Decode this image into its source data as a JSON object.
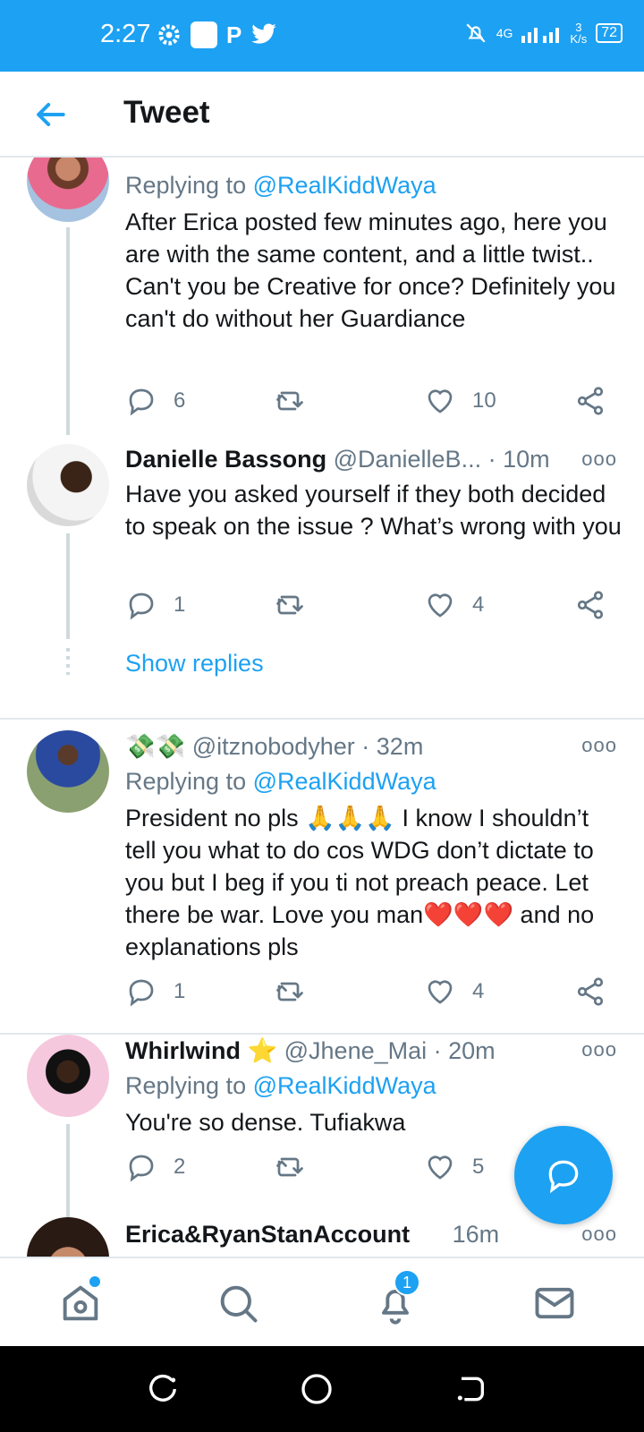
{
  "status_bar": {
    "time": "2:27",
    "left_icons": [
      "gear-icon",
      "square-icon",
      "p-icon",
      "twitter-bird-icon"
    ],
    "p_glyph": "P",
    "network": "4G",
    "speed": "3",
    "speed_unit": "K/s",
    "battery": "72"
  },
  "header": {
    "title": "Tweet",
    "back_icon": "back-arrow-icon"
  },
  "colors": {
    "accent": "#1da1f2",
    "muted": "#657786",
    "text": "#14171a",
    "divider": "#e1e8ed"
  },
  "tweets": [
    {
      "replying_label": "Replying to",
      "mention": "@RealKiddWaya",
      "body": "After Erica posted few minutes ago, here you are with the same content, and a little twist..\nCan't you be Creative for once? Definitely you can't do without her Guardiance",
      "counts": {
        "reply": "6",
        "like": "10"
      }
    },
    {
      "name": "Danielle Bassong",
      "handle": "@DanielleB...",
      "time": "· 10m",
      "body": "Have you asked yourself if they both decided to speak on the issue ? What’s wrong with you",
      "counts": {
        "reply": "1",
        "like": "4"
      }
    },
    {
      "name": "💸💸",
      "handle": "@itznobodyher",
      "time": "· 32m",
      "replying_label": "Replying to",
      "mention": "@RealKiddWaya",
      "body": "President no pls 🙏🙏🙏 I know I shouldn’t tell you what to do cos WDG don’t dictate to you but I beg if you ti not preach peace. Let there be war. Love you man❤️❤️❤️ and no explanations pls",
      "counts": {
        "reply": "1",
        "like": "4"
      }
    },
    {
      "name": "Whirlwind ⭐",
      "handle": "@Jhene_Mai",
      "time": "· 20m",
      "replying_label": "Replying to",
      "mention": "@RealKiddWaya",
      "body": "You're so dense. Tufiakwa",
      "counts": {
        "reply": "2",
        "like": "5"
      }
    },
    {
      "name": "Erica&RyanStanAccount",
      "time": "16m"
    }
  ],
  "show_replies": "Show replies",
  "more_glyph": "ooo",
  "bottom_nav": {
    "items": [
      "home-icon",
      "search-icon",
      "notifications-icon",
      "messages-icon"
    ],
    "notification_badge": "1"
  },
  "fab": {
    "icon": "compose-reply-icon"
  }
}
